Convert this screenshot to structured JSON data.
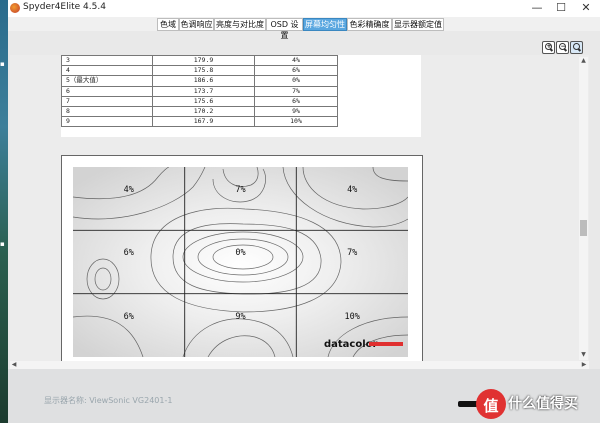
{
  "window": {
    "title": "Spyder4Elite 4.5.4",
    "minimize": "—",
    "maximize": "☐",
    "close": "✕"
  },
  "tabs": [
    {
      "label": "色域",
      "active": false
    },
    {
      "label": "色调响应",
      "active": false
    },
    {
      "label": "亮度与对比度",
      "active": false
    },
    {
      "label": "OSD 设置",
      "active": false
    },
    {
      "label": "屏幕均匀性",
      "active": true
    },
    {
      "label": "色彩精确度",
      "active": false
    },
    {
      "label": "显示器额定值",
      "active": false
    }
  ],
  "toolbar": {
    "zoom_in": "+",
    "zoom_out": "−",
    "zoom_fit": ""
  },
  "table": {
    "rows": [
      [
        "3",
        "179.9",
        "4%"
      ],
      [
        "4",
        "175.8",
        "6%"
      ],
      [
        "5（最大值）",
        "186.6",
        "0%"
      ],
      [
        "6",
        "173.7",
        "7%"
      ],
      [
        "7",
        "175.6",
        "6%"
      ],
      [
        "8",
        "170.2",
        "9%"
      ],
      [
        "9",
        "167.9",
        "10%"
      ]
    ]
  },
  "uniformity": {
    "cells": [
      "4%",
      "7%",
      "4%",
      "6%",
      "0%",
      "7%",
      "6%",
      "9%",
      "10%"
    ],
    "brand": "datacolor"
  },
  "footer": {
    "monitor_label": "显示器名称: ViewSonic VG2401-1"
  },
  "watermark": {
    "text": "什么值得买",
    "logo_char": "值"
  },
  "colors": {
    "active_tab": "#5aa7e0",
    "brand_bar": "#e03030"
  }
}
